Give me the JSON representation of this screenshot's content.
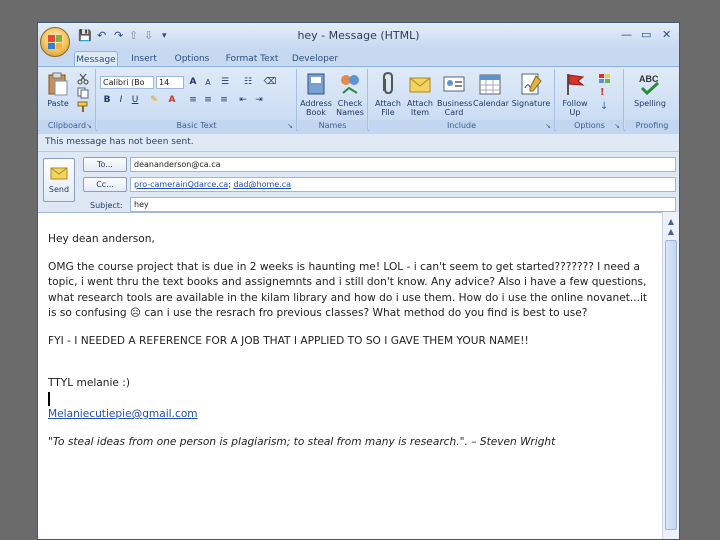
{
  "window": {
    "title": "hey - Message (HTML)",
    "quick_access": {
      "save": "💾",
      "undo": "↶",
      "redo": "↷",
      "prev": "⇧",
      "next": "⇩",
      "more": "▾"
    },
    "controls": {
      "minimize": "—",
      "maximize": "▭",
      "close": "✕"
    }
  },
  "tabs": [
    "Message",
    "Insert",
    "Options",
    "Format Text",
    "Developer"
  ],
  "ribbon": {
    "clipboard": {
      "label": "Clipboard",
      "paste": "Paste"
    },
    "basic_text": {
      "label": "Basic Text",
      "font": "Calibri (Bo",
      "size": "14"
    },
    "names": {
      "label": "Names",
      "address_book": "Address Book",
      "check_names": "Check Names"
    },
    "include": {
      "label": "Include",
      "attach_file": "Attach File",
      "attach_item": "Attach Item",
      "business_card": "Business Card",
      "calendar": "Calendar",
      "signature": "Signature"
    },
    "options": {
      "label": "Options",
      "follow_up": "Follow Up"
    },
    "proofing": {
      "label": "Proofing",
      "spelling": "Spelling"
    }
  },
  "info_bar": "This message has not been sent.",
  "header": {
    "send": "Send",
    "to_button": "To...",
    "cc_button": "Cc...",
    "subject_label": "Subject:",
    "to_value": "deananderson@ca.ca",
    "cc_values": [
      "pro-camerainQdarce.ca",
      "dad@home.ca"
    ],
    "subject_value": "hey"
  },
  "body": {
    "greeting": "Hey dean anderson,",
    "paragraph1": "OMG the course project that is due in 2 weeks is haunting me! LOL - i can't seem to get started??????? I need a topic, i went thru the text books and assignemnts and i still don't know. Any advice? Also i have a few questions, what research tools are available in the kilam library and how do i use them. How do i use the online novanet...it is so confusing ☹ can i use the resrach fro previous classes? What method do you find is best to use?",
    "paragraph2": "FYI - I NEEDED A REFERENCE FOR A JOB THAT I APPLIED TO SO I GAVE THEM YOUR NAME!!",
    "signoff": "TTYL melanie :)",
    "email": "Melaniecutiepie@gmail.com",
    "quote": "\"To steal ideas from one person is plagiarism; to steal from many is research.\". – Steven Wright"
  },
  "scrollbar": {
    "up": "▲",
    "down": "▼"
  }
}
